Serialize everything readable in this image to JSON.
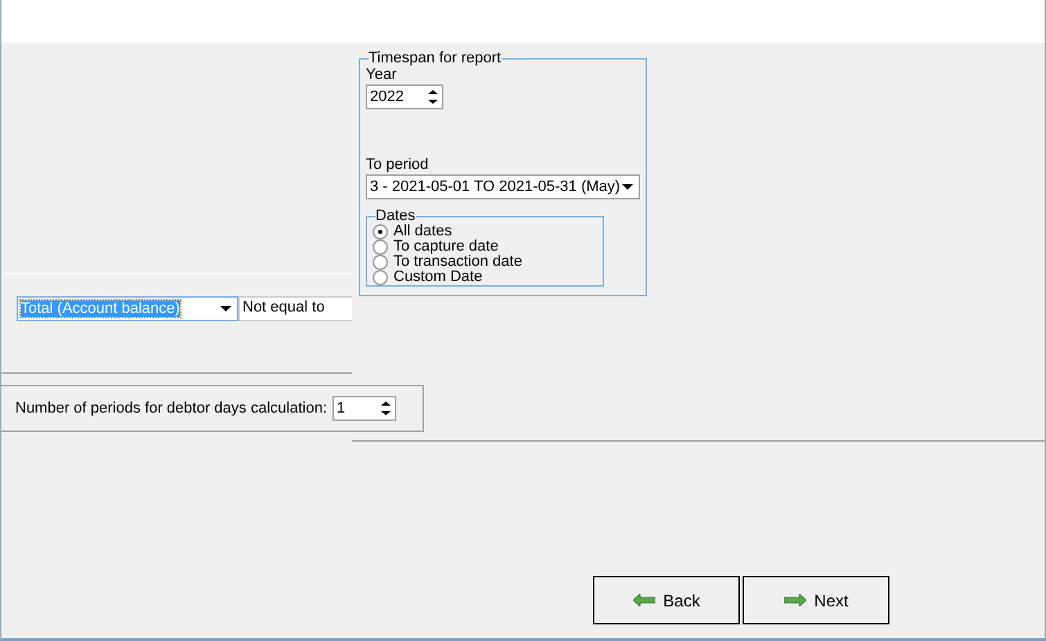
{
  "timespan": {
    "title": "Timespan for report",
    "year_label": "Year",
    "year": "2022",
    "period_label": "To period",
    "period": "3  - 2021-05-01 TO 2021-05-31 (May)",
    "dates": {
      "title": "Dates",
      "options": [
        {
          "label": "All dates",
          "selected": true
        },
        {
          "label": "To capture date",
          "selected": false
        },
        {
          "label": "To transaction date",
          "selected": false
        },
        {
          "label": "Custom Date",
          "selected": false
        }
      ]
    }
  },
  "filter": {
    "field": "Total (Account balance)",
    "operator": "Not equal to"
  },
  "debtor_days": {
    "label": "Number of periods for debtor days calculation:",
    "value": "1"
  },
  "buttons": [
    {
      "label": "Back",
      "kind": "back"
    },
    {
      "label": "Next",
      "kind": "next"
    }
  ]
}
